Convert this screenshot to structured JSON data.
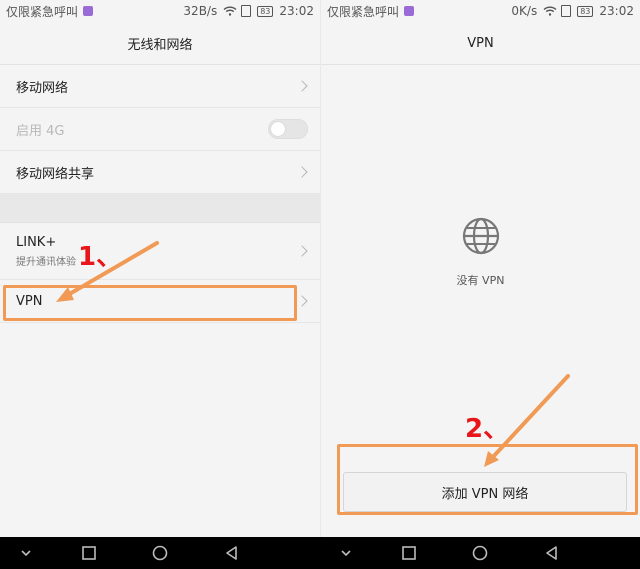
{
  "status": {
    "carrier": "仅限紧急呼叫",
    "left_speed": "32B/s",
    "right_speed": "0K/s",
    "battery": "83",
    "time": "23:02"
  },
  "left": {
    "title": "无线和网络",
    "items": [
      {
        "label": "移动网络"
      },
      {
        "label": "启用 4G"
      },
      {
        "label": "移动网络共享"
      },
      {
        "label": "LINK+",
        "sub": "提升通讯体验"
      },
      {
        "label": "VPN"
      }
    ]
  },
  "right": {
    "title": "VPN",
    "empty_text": "没有 VPN",
    "add_button": "添加 VPN 网络"
  },
  "annotations": {
    "step1": "1、",
    "step2": "2、",
    "color": "#f09a55",
    "number_color": "#e8161b"
  },
  "icons": [
    "purple-app-icon",
    "wifi-icon",
    "sim-icon",
    "battery-icon",
    "chevron-right-icon",
    "globe-icon",
    "back-icon",
    "home-icon",
    "recent-icon",
    "down-icon"
  ]
}
